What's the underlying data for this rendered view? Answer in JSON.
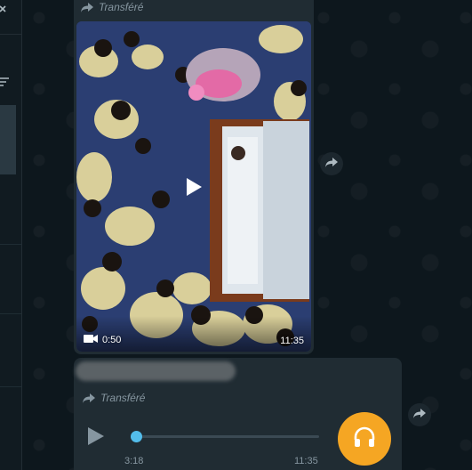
{
  "video_message": {
    "forwarded_label": "Transféré",
    "duration": "0:50",
    "time": "11:35"
  },
  "audio_message": {
    "forwarded_label": "Transféré",
    "duration": "3:18",
    "time": "11:35",
    "progress": 0.03
  },
  "icons": {
    "forward": "forward-arrow-icon",
    "play": "play-icon",
    "video": "video-camera-icon",
    "headphones": "headphones-icon",
    "close": "close-icon",
    "filter": "filter-icon"
  },
  "colors": {
    "bubble": "#202c33",
    "background": "#0b141a",
    "accent_blue": "#53bdeb",
    "avatar_orange": "#f5a623",
    "meta_text": "#8696a0"
  }
}
